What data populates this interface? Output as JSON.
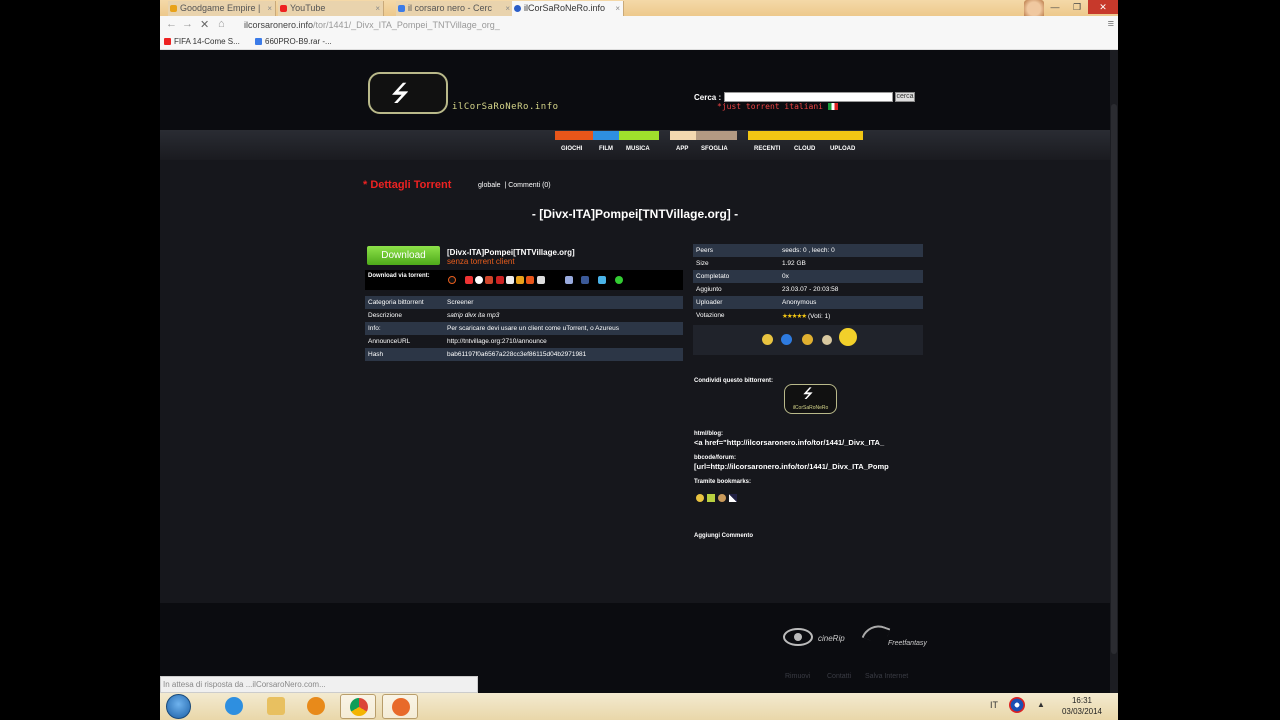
{
  "browser": {
    "tabs": [
      {
        "title": "Goodgame Empire |",
        "icon_color": "#e8a21a"
      },
      {
        "title": "YouTube",
        "icon_color": "#e22"
      },
      {
        "title": "il corsaro nero - Cerc",
        "icon_color": "#3b7be8"
      },
      {
        "title": "ilCorSaRoNeRo.info",
        "icon_color": "#2a5dc8"
      }
    ],
    "url_domain": "ilcorsaronero.info",
    "url_path": "/tor/1441/_Divx_ITA_Pompei_TNTVillage_org_",
    "bookmarks": [
      {
        "label": "FIFA 14-Come S...",
        "icon_color": "#e22"
      },
      {
        "label": "660PRO-B9.rar -...",
        "icon_color": "#3b7be8"
      }
    ],
    "status_text": "In attesa di risposta da ...ilCorsaroNero.com..."
  },
  "site": {
    "logo_text": "ilCorSaRoNeRo.info",
    "search_label": "Cerca :",
    "search_value": "",
    "search_button": "cerca",
    "tagline": "*just torrent italiani",
    "nav": [
      {
        "label": "GIOCHI",
        "color": "#e8561a"
      },
      {
        "label": "FILM",
        "color": "#2e8fe0"
      },
      {
        "label": "MUSICA",
        "color": "#9fe02c"
      },
      {
        "label": "APP",
        "color": "#f3d8b0"
      },
      {
        "label": "SFOGLIA",
        "color": "#b39a83"
      },
      {
        "label": "RECENTI",
        "color": "#f2c614"
      },
      {
        "label": "CLOUD",
        "color": "#f2c614"
      },
      {
        "label": "UPLOAD",
        "color": "#f2c614"
      }
    ]
  },
  "torrent": {
    "section_title": "* Dettagli Torrent",
    "tab_global": "globale",
    "tab_comments": "| Commenti (0)",
    "title": "- [Divx-ITA]Pompei[TNTVillage.org] -",
    "download_label": "Download",
    "name": "[Divx-ITA]Pompei[TNTVillage.org]",
    "no_client": "senza torrent client",
    "download_via": "Download via torrent:",
    "left_rows": [
      {
        "key": "Categoria bittorrent",
        "value": "Screener"
      },
      {
        "key": "Descrizione",
        "value": "satrip divx ita mp3"
      },
      {
        "key": "Info:",
        "value": "Per scaricare devi usare un client come uTorrent, o Azureus"
      },
      {
        "key": "AnnounceURL",
        "value": "http://tntvillage.org:2710/announce"
      },
      {
        "key": "Hash",
        "value": "bab61197f0a6567a228cc3ef86115d04b2971981"
      }
    ],
    "right_rows": [
      {
        "key": "Peers",
        "value": "seeds: 0 , leech: 0"
      },
      {
        "key": "Size",
        "value": "1.92 GB"
      },
      {
        "key": "Completato",
        "value": "0x"
      },
      {
        "key": "Aggiunto",
        "value": "23.03.07 - 20:03:58"
      },
      {
        "key": "Uploader",
        "value": "Anonymous"
      },
      {
        "key": "Votazione",
        "stars": "★★★★★",
        "value": "(Voti: 1)"
      }
    ],
    "share_label": "Condividi questo bittorrent:",
    "share_logo_text": "ilCorSaRoNeRo",
    "html_label": "html/blog:",
    "html_code": "<a href=\"http://ilcorsaronero.info/tor/1441/_Divx_ITA_",
    "bb_label": "bbcode/forum:",
    "bb_code": "[url=http://ilcorsaronero.info/tor/1441/_Divx_ITA_Pomp",
    "bookmarks_label": "Tramite bookmarks:",
    "add_comment": "Aggiungi Commento"
  },
  "footer": {
    "partner1": "cineRip",
    "partner2": "Freetfantasy",
    "links": [
      "Rimuovi",
      "Contatti",
      "Salva Internet"
    ]
  },
  "taskbar": {
    "lang": "IT",
    "time": "16:31",
    "date": "03/03/2014"
  }
}
